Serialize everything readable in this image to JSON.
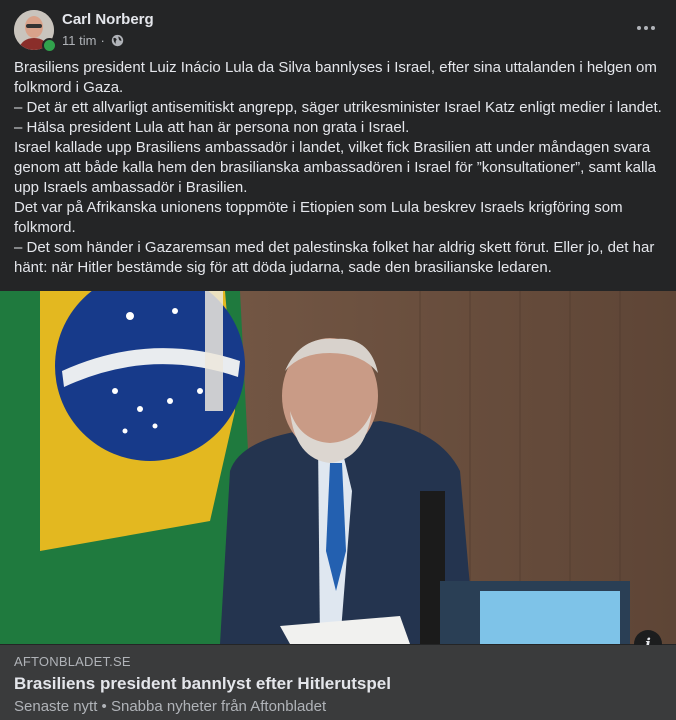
{
  "post": {
    "author": "Carl Norberg",
    "time": "11 tim",
    "separator": "·",
    "privacy_icon": "globe-icon",
    "more_icon": "more-horizontal-icon",
    "paragraphs": [
      "Brasiliens president Luiz Inácio Lula da Silva bannlyses i Israel, efter sina uttalanden i helgen om folkmord i Gaza.",
      "– Det är ett allvarligt antisemitiskt angrepp, säger utrikesminister Israel Katz enligt medier i landet.",
      "– Hälsa president Lula att han är persona non grata i Israel.",
      "Israel kallade upp Brasiliens ambassadör i landet, vilket fick Brasilien att under måndagen svara genom att både kalla hem den brasilianska ambassadören i Israel för ”konsultationer”, samt kalla upp Israels ambassadör i Brasilien.",
      "Det var på Afrikanska unionens toppmöte i Etiopien som Lula beskrev Israels krigföring som folkmord.",
      "– Det som händer i Gazaremsan med det palestinska folket har aldrig skett förut. Eller jo, det har hänt: när Hitler bestämde sig för att döda judarna, sade den brasilianske ledaren."
    ]
  },
  "link": {
    "domain": "AFTONBLADET.SE",
    "title": "Brasiliens president bannlyst efter Hitlerutspel",
    "subtitle": "Senaste nytt • Snabba nyheter från Aftonbladet",
    "info_label": "i"
  },
  "colors": {
    "background": "#242526",
    "card": "#3a3b3c",
    "text_primary": "#e4e6eb",
    "text_secondary": "#b0b3b8",
    "online": "#31a24c"
  }
}
